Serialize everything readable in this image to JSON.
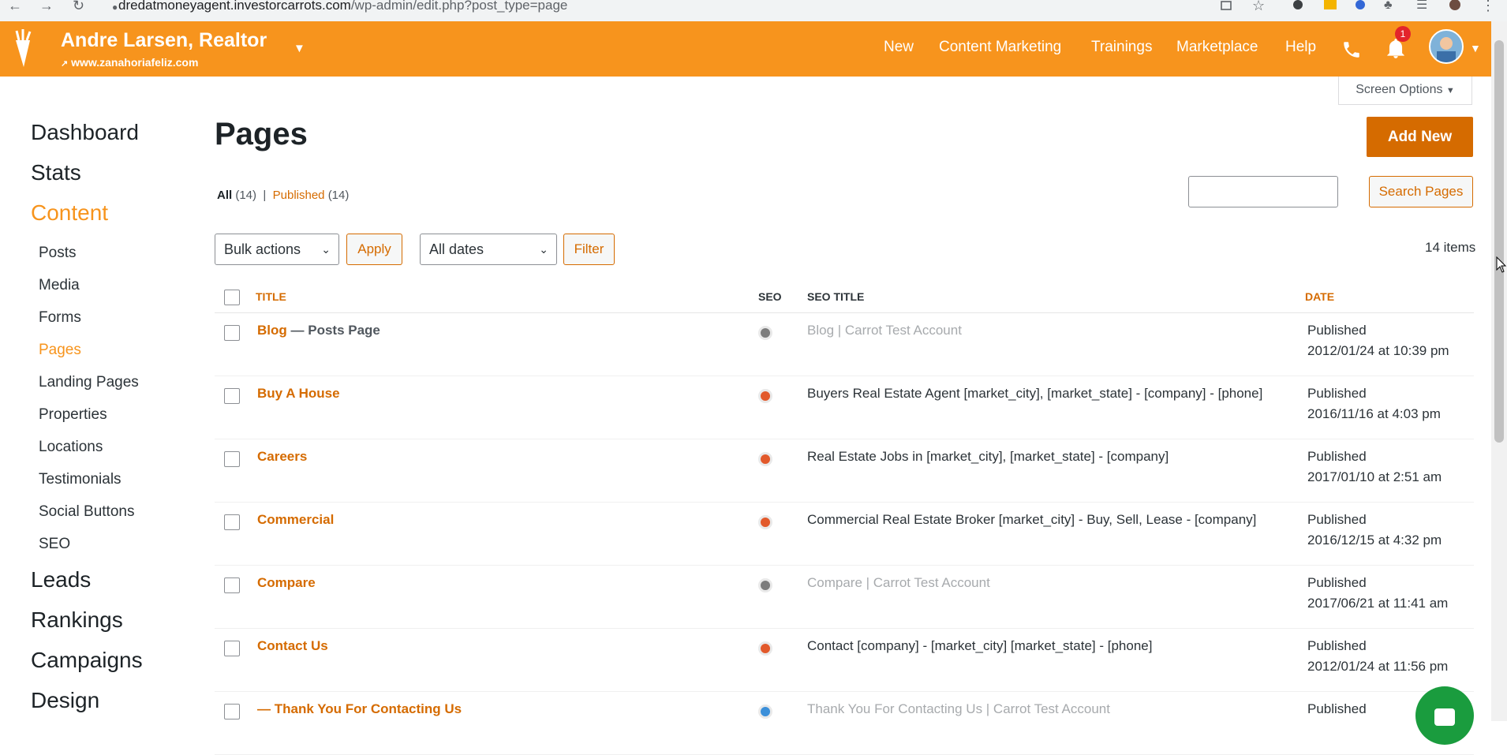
{
  "browser": {
    "url_host": "dredatmoneyagent.investorcarrots.com",
    "url_path": "/wp-admin/edit.php?post_type=page"
  },
  "topnav": {
    "site_name": "Andre Larsen, Realtor",
    "site_url": "www.zanahoriafeliz.com",
    "menu": [
      "New",
      "Content Marketing",
      "Trainings",
      "Marketplace",
      "Help"
    ],
    "notification_count": "1",
    "brand_color": "#f7941d"
  },
  "sidebar": {
    "main_items": [
      "Dashboard",
      "Stats",
      "Content",
      "Leads",
      "Rankings",
      "Campaigns",
      "Design"
    ],
    "active_main": "Content",
    "sub_items": [
      "Posts",
      "Media",
      "Forms",
      "Pages",
      "Landing Pages",
      "Properties",
      "Locations",
      "Testimonials",
      "Social Buttons",
      "SEO"
    ],
    "active_sub": "Pages"
  },
  "main": {
    "screen_options": "Screen Options",
    "title": "Pages",
    "add_new": "Add New",
    "filters": {
      "all_label": "All",
      "all_count": "(14)",
      "separator": "|",
      "published_label": "Published",
      "published_count": "(14)"
    },
    "search_button": "Search Pages",
    "search_value": "",
    "bulk_actions": "Bulk actions",
    "apply": "Apply",
    "all_dates": "All dates",
    "filter": "Filter",
    "item_count": "14 items",
    "columns": {
      "title": "TITLE",
      "seo": "SEO",
      "seo_title": "SEO TITLE",
      "date": "DATE"
    },
    "rows": [
      {
        "title": "Blog",
        "state": " — Posts Page",
        "seo_status": "grey",
        "seo_title": "Blog | Carrot Test Account",
        "seo_dim": true,
        "status": "Published",
        "date": "2012/01/24 at 10:39 pm"
      },
      {
        "title": "Buy A House",
        "state": "",
        "seo_status": "red",
        "seo_title": "Buyers Real Estate Agent [market_city], [market_state] - [company] - [phone]",
        "seo_dim": false,
        "status": "Published",
        "date": "2016/11/16 at 4:03 pm"
      },
      {
        "title": "Careers",
        "state": "",
        "seo_status": "red",
        "seo_title": "Real Estate Jobs in [market_city], [market_state] - [company]",
        "seo_dim": false,
        "status": "Published",
        "date": "2017/01/10 at 2:51 am"
      },
      {
        "title": "Commercial",
        "state": "",
        "seo_status": "red",
        "seo_title": "Commercial Real Estate Broker [market_city] - Buy, Sell, Lease - [company]",
        "seo_dim": false,
        "status": "Published",
        "date": "2016/12/15 at 4:32 pm"
      },
      {
        "title": "Compare",
        "state": "",
        "seo_status": "grey",
        "seo_title": "Compare | Carrot Test Account",
        "seo_dim": true,
        "status": "Published",
        "date": "2017/06/21 at 11:41 am"
      },
      {
        "title": "Contact Us",
        "state": "",
        "seo_status": "red",
        "seo_title": "Contact [company] - [market_city] [market_state] - [phone]",
        "seo_dim": false,
        "status": "Published",
        "date": "2012/01/24 at 11:56 pm"
      },
      {
        "title": "— Thank You For Contacting Us",
        "state": "",
        "seo_status": "blue",
        "seo_title": "Thank You For Contacting Us | Carrot Test Account",
        "seo_dim": true,
        "status": "Published",
        "date": ""
      }
    ],
    "status_colors": {
      "grey": "#7c7c7c",
      "red": "#e2592b",
      "blue": "#3b8fd9"
    }
  },
  "icons": [
    "back-icon",
    "forward-icon",
    "reload-icon",
    "lock-icon",
    "share-icon",
    "star-icon",
    "extension-icon",
    "puzzle-icon",
    "playlist-icon",
    "profile-icon",
    "menu-icon",
    "carrot-logo-icon",
    "external-link-icon",
    "chevron-down-icon",
    "phone-icon",
    "bell-icon",
    "chat-icon",
    "cursor-icon"
  ]
}
